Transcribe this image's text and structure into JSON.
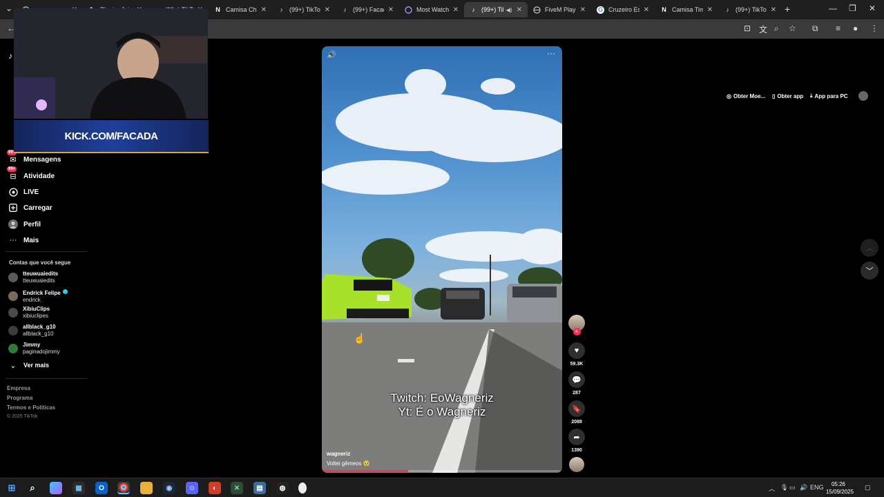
{
  "browser": {
    "tabs": [
      {
        "label": "",
        "favicon": "",
        "active": false,
        "sound": false
      },
      {
        "label": "Plagiar Joia",
        "favicon": "pen-icon",
        "active": false,
        "sound": false
      },
      {
        "label": "(99+) TikTok",
        "favicon": "tiktok-icon",
        "active": false,
        "sound": false
      },
      {
        "label": "Camisa Che",
        "favicon": "N",
        "active": false,
        "sound": false
      },
      {
        "label": "(99+) TikTok",
        "favicon": "tiktok-icon",
        "active": false,
        "sound": false
      },
      {
        "label": "(99+) Facada",
        "favicon": "tiktok-icon",
        "active": false,
        "sound": false
      },
      {
        "label": "Most Watch",
        "favicon": "stream-icon",
        "active": false,
        "sound": false
      },
      {
        "label": "(99+) Tik",
        "favicon": "tiktok-icon",
        "active": true,
        "sound": true
      },
      {
        "label": "FiveM Player",
        "favicon": "globe-icon",
        "active": false,
        "sound": false
      },
      {
        "label": "Cruzeiro Esp",
        "favicon": "G",
        "active": false,
        "sound": false
      },
      {
        "label": "Camisa Tim",
        "favicon": "N",
        "active": false,
        "sound": false
      },
      {
        "label": "(99+) TikTok",
        "favicon": "tiktok-icon",
        "active": false,
        "sound": false
      }
    ]
  },
  "sidebar": {
    "items": [
      {
        "label": "Mensagens",
        "icon": "message-icon",
        "badge": "99+"
      },
      {
        "label": "Atividade",
        "icon": "inbox-icon",
        "badge": "99+"
      },
      {
        "label": "LIVE",
        "icon": "live-icon",
        "badge": ""
      },
      {
        "label": "Carregar",
        "icon": "plus-box-icon",
        "badge": ""
      },
      {
        "label": "Perfil",
        "icon": "avatar-icon",
        "badge": ""
      },
      {
        "label": "Mais",
        "icon": "more-icon",
        "badge": ""
      }
    ],
    "following_title": "Contas que você segue",
    "following": [
      {
        "name": "tteuwuaiedits",
        "handle": "tteuwuaiedits",
        "verified": false
      },
      {
        "name": "Endrick Felipe",
        "handle": "endrick",
        "verified": true
      },
      {
        "name": "XibiuClips",
        "handle": "xibiuclipes",
        "verified": false
      },
      {
        "name": "allblack_g10",
        "handle": "allblack_g10",
        "verified": false
      },
      {
        "name": "Jimmy",
        "handle": "paginadojimmy",
        "verified": false
      }
    ],
    "see_more": "Ver mais",
    "footer": [
      "Empresa",
      "Programa",
      "Termos e Políticas"
    ],
    "copyright": "© 2025 TikTok"
  },
  "overlay": {
    "banner_text": "KICK.COM/FACADA"
  },
  "topbar": {
    "get_coins": "Obter Moe...",
    "get_app": "Obter app",
    "pc_app": "App para PC"
  },
  "video": {
    "caption_line1": "Twitch: EoWagneriz",
    "caption_line2": "Yt: É o Wagneriz",
    "author": "wagneriz",
    "description": "Voltei gêmeos 🥹",
    "progress": 0.36
  },
  "actions": {
    "likes": "59.3K",
    "comments": "287",
    "saves": "2088",
    "shares": "1390"
  },
  "taskbar": {
    "language": "ENG",
    "time": "05:26",
    "date": "15/09/2025"
  },
  "colors": {
    "accent": "#fe2c55",
    "browser_bg": "#1f1f1f",
    "toolbar_bg": "#3a3a3a"
  }
}
